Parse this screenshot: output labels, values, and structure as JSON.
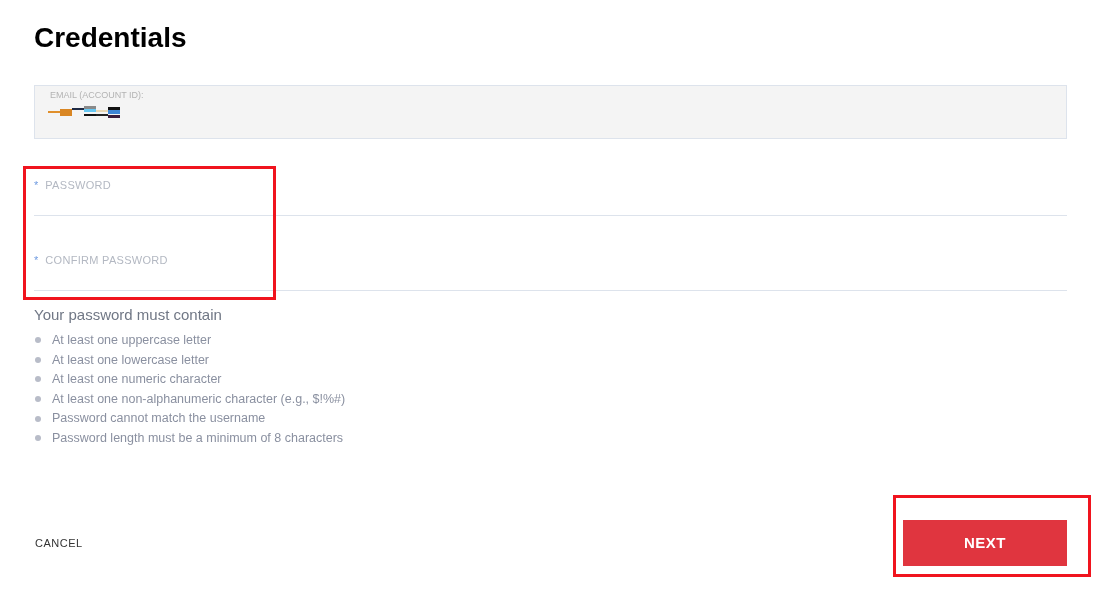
{
  "title": "Credentials",
  "account": {
    "label": "EMAIL (ACCOUNT ID):"
  },
  "fields": [
    {
      "label": "PASSWORD",
      "required_mark": "*"
    },
    {
      "label": "CONFIRM PASSWORD",
      "required_mark": "*"
    }
  ],
  "rules": {
    "heading": "Your password must contain",
    "items": [
      "At least one uppercase letter",
      "At least one lowercase letter",
      "At least one numeric character",
      "At least one non-alphanumeric character (e.g., $!%#)",
      "Password cannot match the username",
      "Password length must be a minimum of 8 characters"
    ]
  },
  "buttons": {
    "cancel": "CANCEL",
    "next": "NEXT"
  }
}
